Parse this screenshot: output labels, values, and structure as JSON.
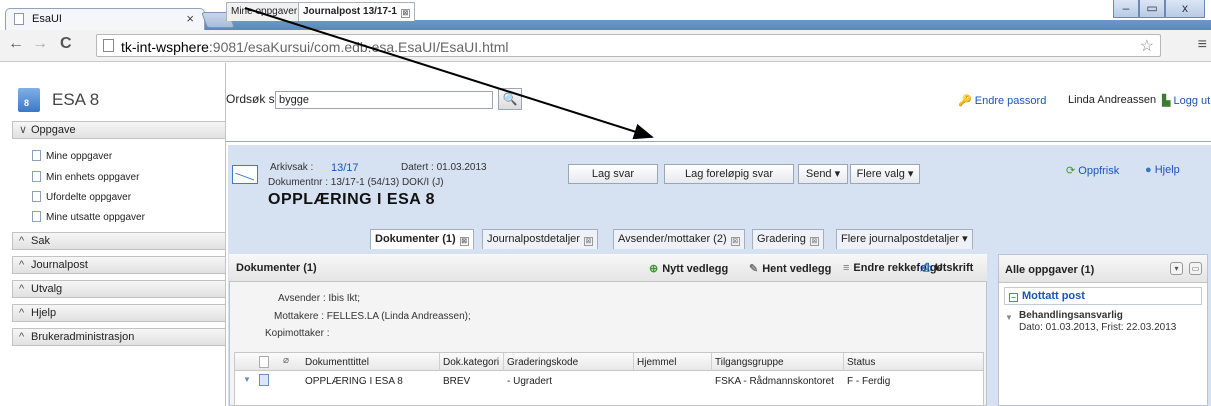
{
  "browser": {
    "tab_title": "EsaUI",
    "tab_close": "×",
    "url_host": "tk-int-wsphere",
    "url_rest": ":9081/esaKursui/com.edb.esa.EsaUI/EsaUI.html",
    "win_min": "–",
    "win_max": "▭",
    "win_close": "x"
  },
  "app": {
    "logo_num": "8",
    "name": "ESA 8"
  },
  "search": {
    "selector": "Ordsøk sak ▾",
    "value": "bygge"
  },
  "topright": {
    "change_pw": "Endre passord",
    "user": "Linda Andreassen",
    "logout": "Logg ut"
  },
  "sidebar": {
    "sections": [
      {
        "label": "Oppgave",
        "chevron": "∨"
      },
      {
        "label": "Sak",
        "chevron": "^"
      },
      {
        "label": "Journalpost",
        "chevron": "^"
      },
      {
        "label": "Utvalg",
        "chevron": "^"
      },
      {
        "label": "Hjelp",
        "chevron": "^"
      },
      {
        "label": "Brukeradministrasjon",
        "chevron": "^"
      }
    ],
    "items": [
      "Mine oppgaver",
      "Min enhets oppgaver",
      "Ufordelte oppgaver",
      "Mine utsatte oppgaver"
    ]
  },
  "tabs": [
    {
      "label": "Mine oppgaver",
      "close": "⊠"
    },
    {
      "label": "Journalpost 13/17-1",
      "close": "⊠"
    }
  ],
  "journal": {
    "arkivsak_label": "Arkivsak :",
    "arkivsak_value": "13/17",
    "datert": "Datert : 01.03.2013",
    "dokumentnr": "Dokumentnr : 13/17-1 (54/13) DOK/I (J)",
    "title": "OPPLÆRING I ESA 8",
    "btn_lag_svar": "Lag svar",
    "btn_lag_forelopig": "Lag foreløpig svar",
    "btn_send": "Send ▾",
    "btn_flere_valg": "Flere valg ▾",
    "oppfrisk": "Oppfrisk",
    "hjelp": "Hjelp"
  },
  "detail_tabs": [
    {
      "label": "Dokumenter (1)",
      "close": "⊠"
    },
    {
      "label": "Journalpostdetaljer",
      "close": "⊠"
    },
    {
      "label": "Avsender/mottaker (2)",
      "close": "⊠"
    },
    {
      "label": "Gradering",
      "close": "⊠"
    },
    {
      "label": "Flere journalpostdetaljer ▾",
      "close": ""
    }
  ],
  "documents": {
    "header": "Dokumenter (1)",
    "nytt_vedlegg": "Nytt vedlegg",
    "hent_vedlegg": "Hent vedlegg",
    "endre_rekkefolge": "Endre rekkefølge",
    "utskrift": "Utskrift",
    "avsender": "Avsender : Ibis Ikt;",
    "mottakere": "Mottakere : FELLES.LA (Linda Andreassen);",
    "kopimottaker": "Kopimottaker :",
    "columns": [
      "Dokumenttittel",
      "Dok.kategori",
      "Graderingskode",
      "Hjemmel",
      "Tilgangsgruppe",
      "Status"
    ],
    "rows": [
      {
        "tittel": "OPPLÆRING I ESA 8",
        "kategori": "BREV",
        "gradering": "- Ugradert",
        "hjemmel": "",
        "tilgang": "FSKA - Rådmannskontoret",
        "status": "F - Ferdig"
      }
    ]
  },
  "right_panel": {
    "header": "Alle oppgaver (1)",
    "group": "Mottatt post",
    "item_title": "Behandlingsansvarlig",
    "item_detail": "Dato: 01.03.2013, Frist: 22.03.2013"
  }
}
